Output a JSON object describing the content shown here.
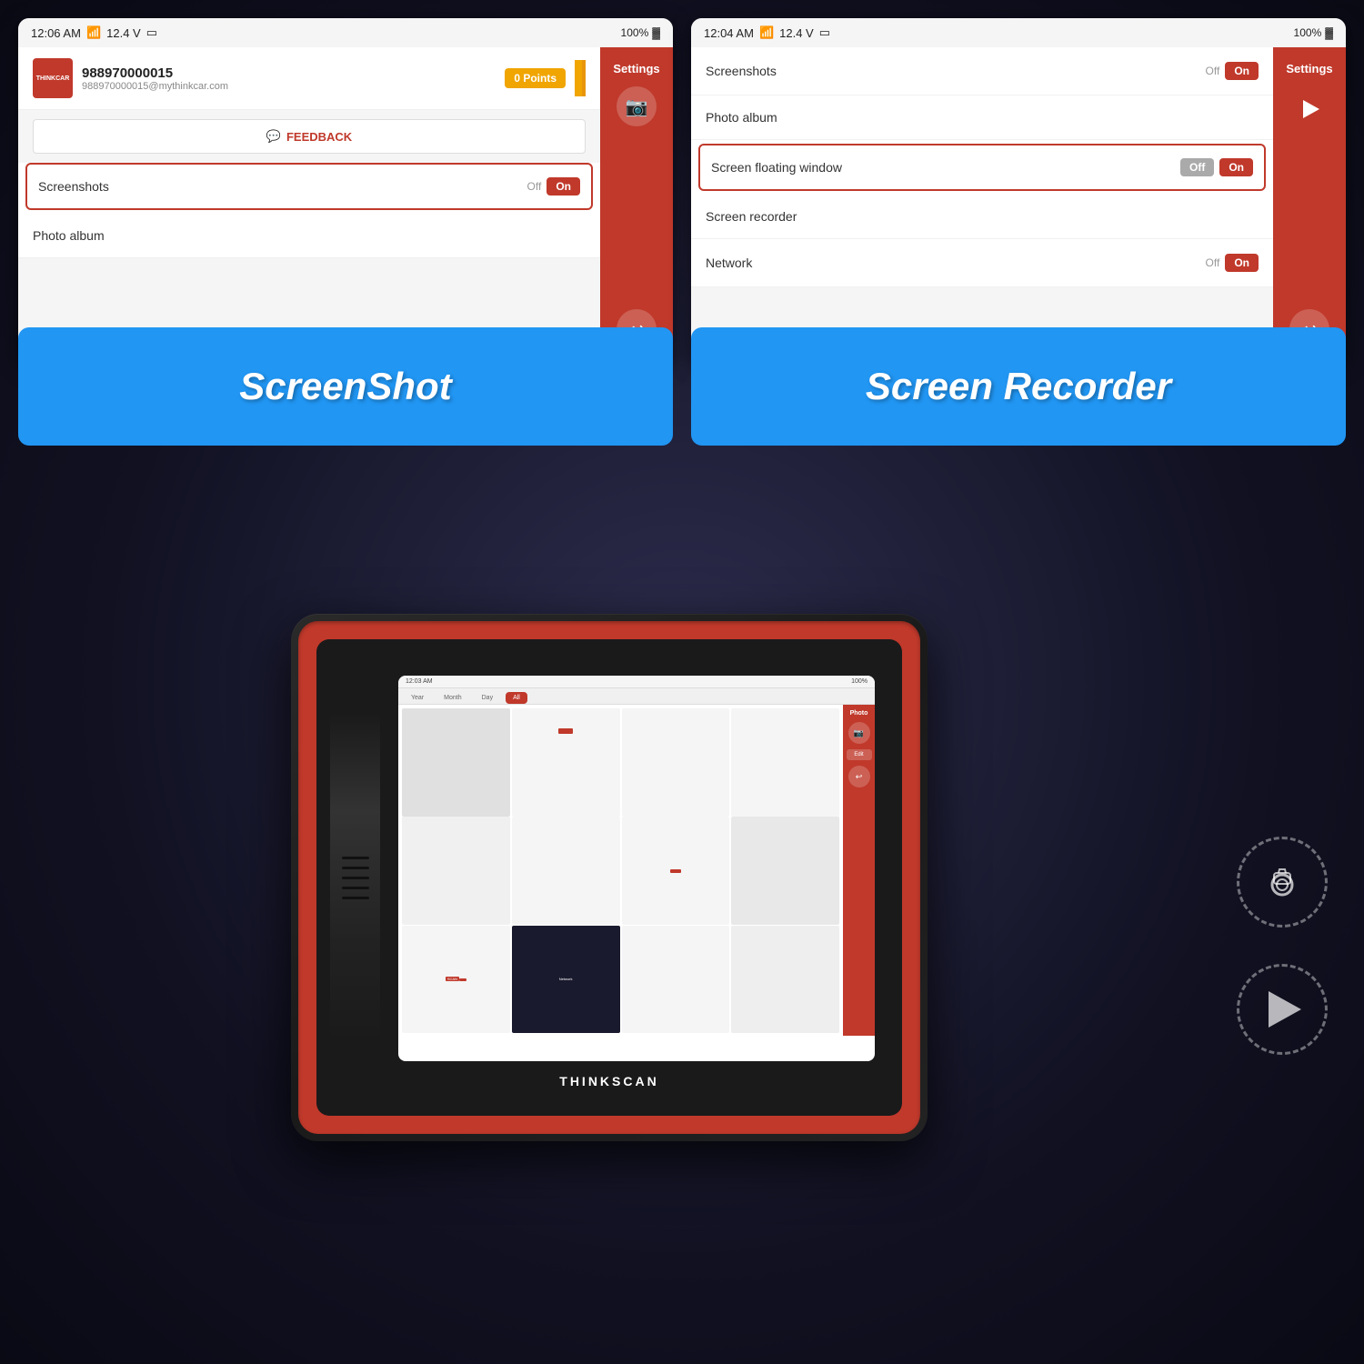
{
  "background": "#1a1a2e",
  "left_panel": {
    "statusbar": {
      "time": "12:06 AM",
      "signal": "📶",
      "voltage": "12.4 V",
      "battery_icon": "🔋",
      "battery_pct": "100%"
    },
    "profile": {
      "logo_text": "THINKCAR",
      "account_number": "988970000015",
      "email": "988970000015@mythinkcar.com",
      "points": "0 Points"
    },
    "feedback_label": "FEEDBACK",
    "settings_title": "Settings",
    "items": [
      {
        "label": "Screenshots",
        "toggle_off": "Off",
        "toggle_on": "On",
        "highlighted": true
      },
      {
        "label": "Photo album",
        "toggle_off": "",
        "toggle_on": ""
      }
    ],
    "sidebar": {
      "title": "Settings",
      "camera_icon": "📷",
      "back_icon": "↩"
    }
  },
  "right_panel": {
    "statusbar": {
      "time": "12:04 AM",
      "signal": "📶",
      "voltage": "12.4 V",
      "battery_icon": "🔋",
      "battery_pct": "100%"
    },
    "settings_title": "Settings",
    "items": [
      {
        "label": "Screenshots",
        "toggle_off": "Off",
        "toggle_on": "On"
      },
      {
        "label": "Photo album"
      },
      {
        "label": "Screen floating window",
        "toggle_off": "Off",
        "toggle_on": "On",
        "highlighted": true
      },
      {
        "label": "Screen recorder"
      },
      {
        "label": "Network",
        "toggle_off": "Off",
        "toggle_on": "On"
      }
    ],
    "sidebar": {
      "title": "Settings",
      "back_icon": "↩"
    }
  },
  "labels": {
    "screenshot_label": "ScreenShot",
    "recorder_label": "Screen Recorder"
  },
  "device": {
    "brand": "THINKSCAN",
    "screen": {
      "time": "12:03 AM",
      "battery": "100%",
      "tabs": [
        "Year",
        "Month",
        "Day",
        "All"
      ],
      "sidebar_label": "Photo",
      "edit_btn": "Edit"
    }
  },
  "icons": {
    "camera": "⊙",
    "play": "▶",
    "back": "↩",
    "feedback": "💬"
  }
}
